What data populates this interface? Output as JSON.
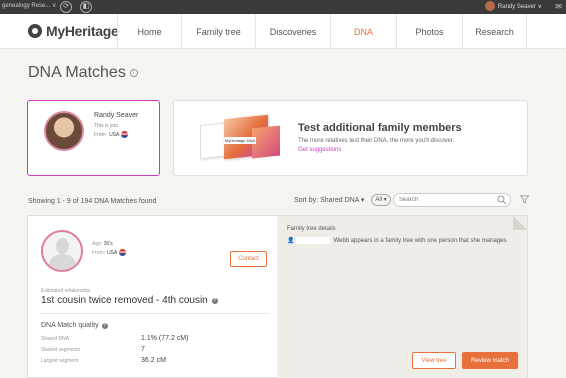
{
  "topbar": {
    "tree_selector": "genealogy Rese... ∨",
    "user_name": "Randy Seaver ∨"
  },
  "logo": {
    "text": "MyHeritage"
  },
  "nav": [
    {
      "label": "Home",
      "active": false
    },
    {
      "label": "Family tree",
      "active": false
    },
    {
      "label": "Discoveries",
      "active": false
    },
    {
      "label": "DNA",
      "active": true
    },
    {
      "label": "Photos",
      "active": false
    },
    {
      "label": "Research",
      "active": false
    }
  ],
  "page": {
    "title": "DNA Matches"
  },
  "profile": {
    "name": "Randy Seaver",
    "subtitle": "This is you",
    "from_label": "From:",
    "country": "USA"
  },
  "promo": {
    "title": "Test additional family members",
    "text": "The more relatives test their DNA, the more you'll discover.",
    "link": "Get suggestions",
    "kit_label": "MyHeritage DNA"
  },
  "results": {
    "showing": "Showing 1 - 9 of 194 DNA Matches found",
    "sort_by": "Sort by: Shared DNA ▾",
    "filter": "All ▾",
    "search_placeholder": "Search"
  },
  "match": {
    "age_label": "Age:",
    "age": "30's",
    "from_label": "From:",
    "country": "USA",
    "contact_label": "Contact",
    "estimated_label": "Estimated relationship",
    "relationship": "1st cousin twice removed - 4th cousin",
    "quality_title": "DNA Match quality",
    "stats": [
      {
        "label": "Shared DNA",
        "value": "1.1% (77.2 cM)"
      },
      {
        "label": "Shared segments",
        "value": "7"
      },
      {
        "label": "Largest segment",
        "value": "36.2 cM"
      }
    ],
    "tree_details_title": "Family tree details",
    "tree_text": "Webb appears in a family tree with one person that she manages",
    "view_tree_label": "View tree",
    "review_label": "Review match"
  },
  "colors": {
    "accent": "#e8703a",
    "highlight": "#c43fbf",
    "topbar": "#3a3a3a"
  }
}
